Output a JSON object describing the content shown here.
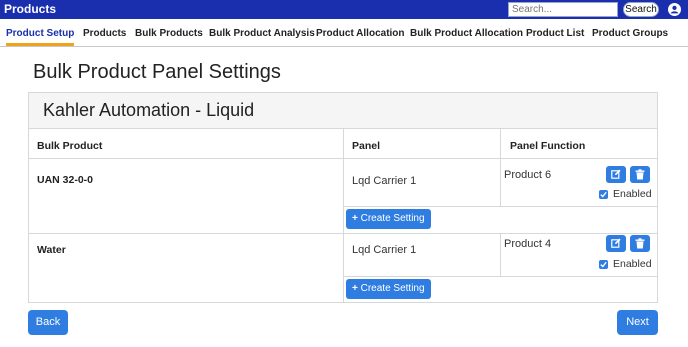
{
  "app": {
    "title": "Products"
  },
  "search": {
    "placeholder": "Search...",
    "button_label": "Search"
  },
  "tabs": [
    {
      "label": "Product Setup",
      "active": true
    },
    {
      "label": "Products"
    },
    {
      "label": "Bulk Products"
    },
    {
      "label": "Bulk Product Analysis"
    },
    {
      "label": "Product Allocation"
    },
    {
      "label": "Bulk Product Allocation"
    },
    {
      "label": "Product List"
    },
    {
      "label": "Product Groups"
    }
  ],
  "page": {
    "title": "Bulk Product Panel Settings"
  },
  "panel": {
    "title": "Kahler Automation - Liquid",
    "columns": [
      "Bulk Product",
      "Panel",
      "Panel Function"
    ],
    "rows": [
      {
        "bulk_product": "UAN 32-0-0",
        "panel": "Lqd Carrier 1",
        "function": "Product 6",
        "enabled_label": "Enabled",
        "enabled": true,
        "create_label": "Create Setting"
      },
      {
        "bulk_product": "Water",
        "panel": "Lqd Carrier 1",
        "function": "Product 4",
        "enabled_label": "Enabled",
        "enabled": true,
        "create_label": "Create Setting"
      }
    ]
  },
  "footer": {
    "back_label": "Back",
    "next_label": "Next"
  },
  "icons": {
    "user": "user-circle-icon",
    "edit": "edit-icon",
    "delete": "trash-icon",
    "plus": "plus-icon",
    "check": "check-icon"
  },
  "colors": {
    "header_bg": "#1a2fae",
    "accent": "#2f7de1",
    "tab_underline": "#f0a21b"
  }
}
